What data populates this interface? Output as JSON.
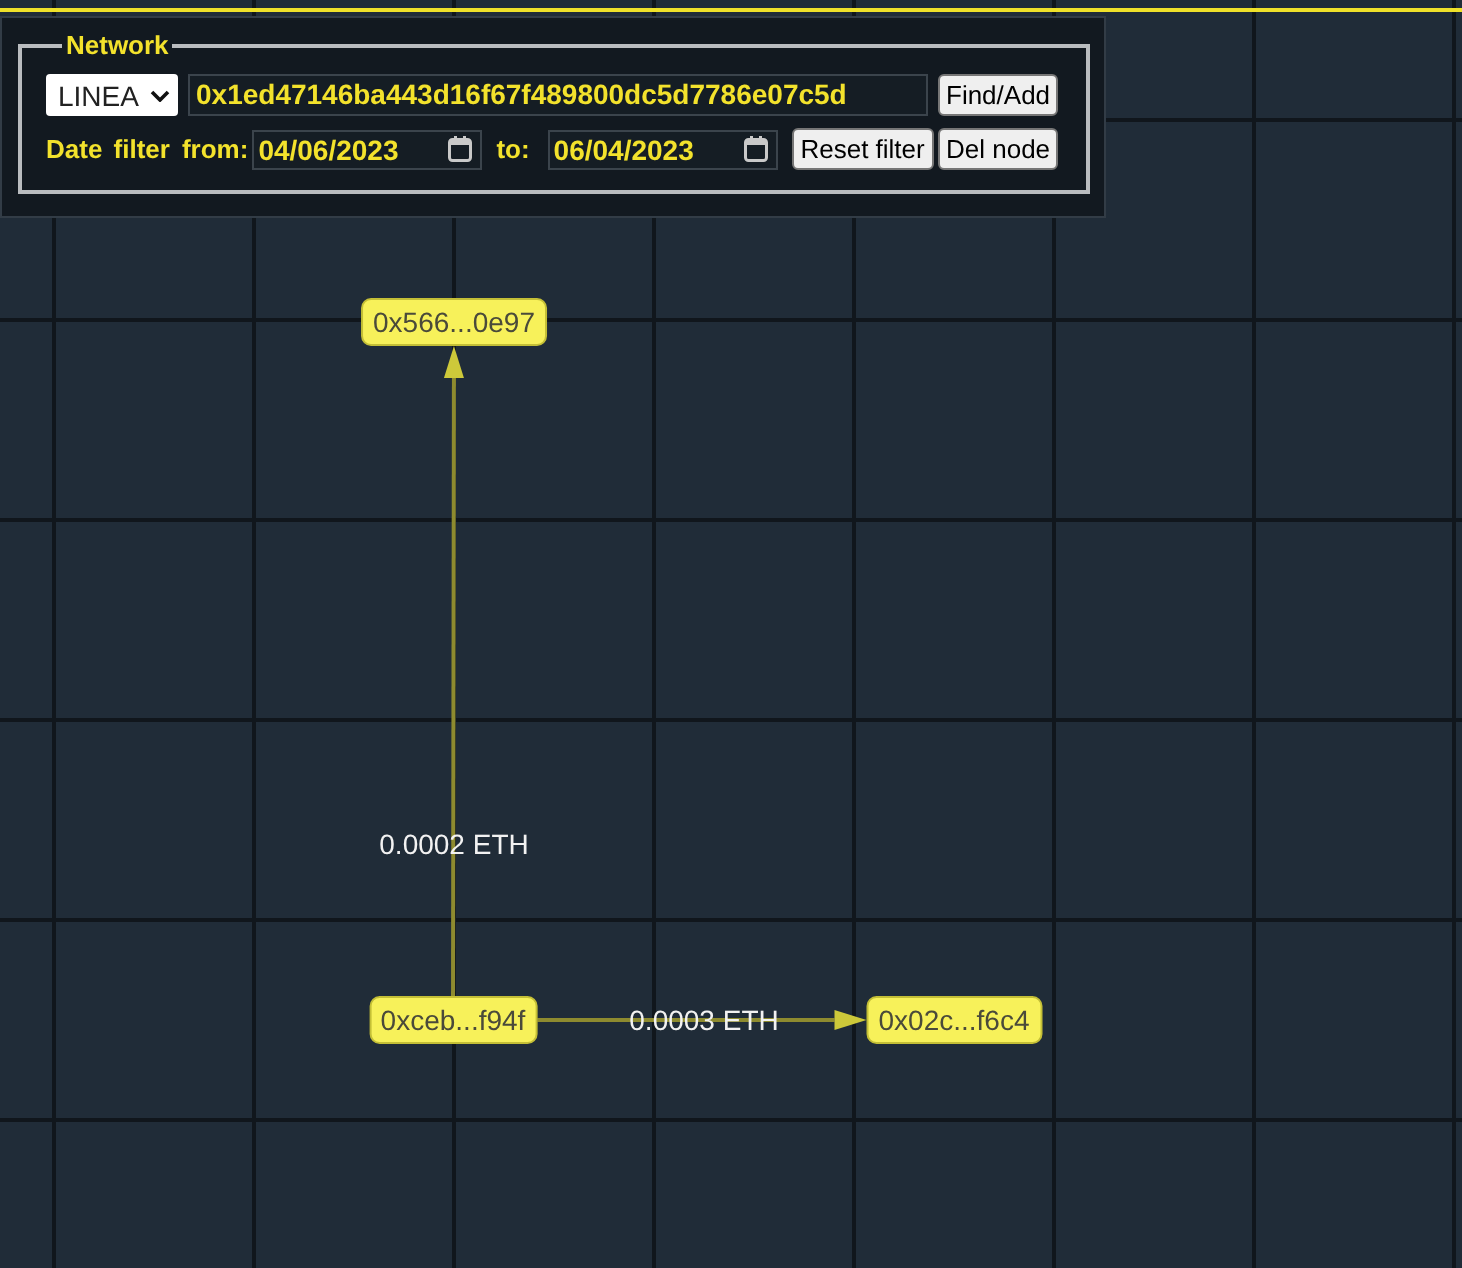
{
  "panel": {
    "legend": "Network",
    "chain_select": {
      "value": "LINEA"
    },
    "address_field": {
      "value": "0x1ed47146ba443d16f67f489800dc5d7786e07c5d"
    },
    "find_button": "Find/Add",
    "date_filter": {
      "label": "Date filter",
      "from_label": "from:",
      "from": {
        "value": "04/06/2023"
      },
      "to_label": "to:",
      "to": {
        "value": "06/04/2023"
      },
      "reset_button": "Reset filter",
      "delete_button": "Del node"
    }
  },
  "graph": {
    "node": {
      "label": "0xceb...f94f",
      "transfers": [
        {
          "amount": "0.0002 ETH",
          "to": {
            "label": "0x566...0e97"
          }
        },
        {
          "amount": "0.0003 ETH",
          "to": {
            "label": "0x02c...f6c4"
          }
        }
      ]
    }
  }
}
